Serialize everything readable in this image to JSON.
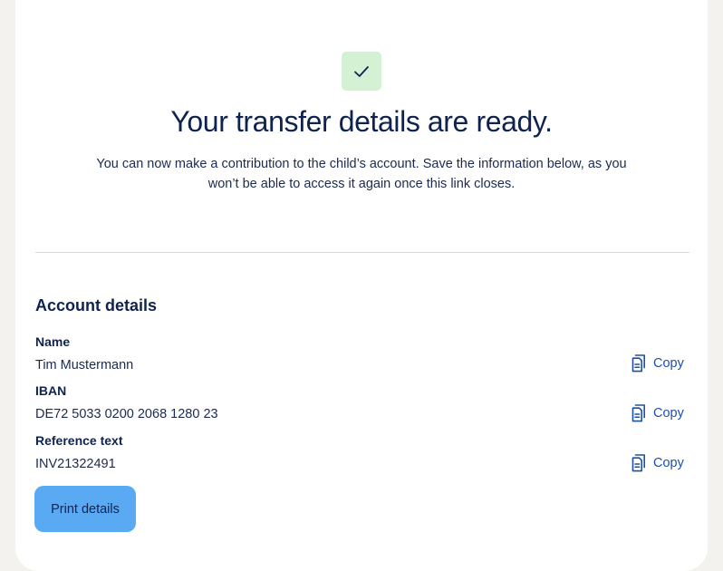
{
  "header": {
    "title": "Your transfer details are ready.",
    "description": "You can now make a contribution to the child’s account. Save the information below, as you won’t be able to access it again once this link closes."
  },
  "account": {
    "section_title": "Account details",
    "copy_label": "Copy",
    "fields": [
      {
        "label": "Name",
        "value": "Tim Mustermann"
      },
      {
        "label": "IBAN",
        "value": "DE72 5033 0200 2068 1280 23"
      },
      {
        "label": "Reference text",
        "value": "INV21322491"
      }
    ]
  },
  "actions": {
    "print_label": "Print details"
  },
  "icons": {
    "status": "checkmark-icon",
    "copy": "copy-icon"
  },
  "colors": {
    "success_bg": "#d5f1d4",
    "primary_button": "#5aa9f3",
    "text_navy": "#0f2350",
    "link_blue": "#1f4fa8"
  }
}
